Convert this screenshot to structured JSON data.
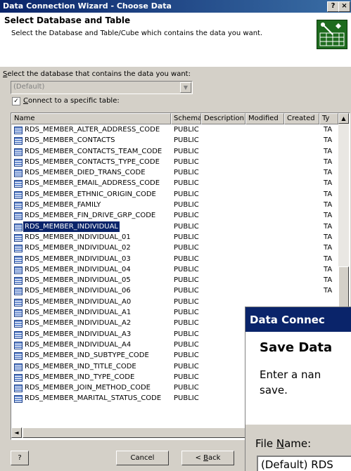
{
  "window": {
    "title": "Data Connection Wizard - Choose Data",
    "help_label": "?",
    "close_label": "×"
  },
  "header": {
    "title": "Select Database and Table",
    "subtitle": "Select the Database and Table/Cube which contains the data you want."
  },
  "database": {
    "label_prefix": "S",
    "label_rest": "elect the database that contains the data you want:",
    "value": "(Default)"
  },
  "connect_checkbox": {
    "checked": "✓",
    "label_prefix": "C",
    "label_rest": "onnect to a specific table:"
  },
  "columns": [
    "Name",
    "Schema",
    "Description",
    "Modified",
    "Created",
    "Ty"
  ],
  "rows": [
    {
      "name": "RDS_MEMBER_ALTER_ADDRESS_CODE",
      "schema": "PUBLIC",
      "type": "TA"
    },
    {
      "name": "RDS_MEMBER_CONTACTS",
      "schema": "PUBLIC",
      "type": "TA"
    },
    {
      "name": "RDS_MEMBER_CONTACTS_TEAM_CODE",
      "schema": "PUBLIC",
      "type": "TA"
    },
    {
      "name": "RDS_MEMBER_CONTACTS_TYPE_CODE",
      "schema": "PUBLIC",
      "type": "TA"
    },
    {
      "name": "RDS_MEMBER_DIED_TRANS_CODE",
      "schema": "PUBLIC",
      "type": "TA"
    },
    {
      "name": "RDS_MEMBER_EMAIL_ADDRESS_CODE",
      "schema": "PUBLIC",
      "type": "TA"
    },
    {
      "name": "RDS_MEMBER_ETHNIC_ORIGIN_CODE",
      "schema": "PUBLIC",
      "type": "TA"
    },
    {
      "name": "RDS_MEMBER_FAMILY",
      "schema": "PUBLIC",
      "type": "TA"
    },
    {
      "name": "RDS_MEMBER_FIN_DRIVE_GRP_CODE",
      "schema": "PUBLIC",
      "type": "TA"
    },
    {
      "name": "RDS_MEMBER_INDIVIDUAL",
      "schema": "PUBLIC",
      "type": "TA",
      "selected": true
    },
    {
      "name": "RDS_MEMBER_INDIVIDUAL_01",
      "schema": "PUBLIC",
      "type": "TA"
    },
    {
      "name": "RDS_MEMBER_INDIVIDUAL_02",
      "schema": "PUBLIC",
      "type": "TA"
    },
    {
      "name": "RDS_MEMBER_INDIVIDUAL_03",
      "schema": "PUBLIC",
      "type": "TA"
    },
    {
      "name": "RDS_MEMBER_INDIVIDUAL_04",
      "schema": "PUBLIC",
      "type": "TA"
    },
    {
      "name": "RDS_MEMBER_INDIVIDUAL_05",
      "schema": "PUBLIC",
      "type": "TA"
    },
    {
      "name": "RDS_MEMBER_INDIVIDUAL_06",
      "schema": "PUBLIC",
      "type": "TA"
    },
    {
      "name": "RDS_MEMBER_INDIVIDUAL_A0",
      "schema": "PUBLIC",
      "type": ""
    },
    {
      "name": "RDS_MEMBER_INDIVIDUAL_A1",
      "schema": "PUBLIC",
      "type": ""
    },
    {
      "name": "RDS_MEMBER_INDIVIDUAL_A2",
      "schema": "PUBLIC",
      "type": ""
    },
    {
      "name": "RDS_MEMBER_INDIVIDUAL_A3",
      "schema": "PUBLIC",
      "type": ""
    },
    {
      "name": "RDS_MEMBER_INDIVIDUAL_A4",
      "schema": "PUBLIC",
      "type": ""
    },
    {
      "name": "RDS_MEMBER_IND_SUBTYPE_CODE",
      "schema": "PUBLIC",
      "type": ""
    },
    {
      "name": "RDS_MEMBER_IND_TITLE_CODE",
      "schema": "PUBLIC",
      "type": ""
    },
    {
      "name": "RDS_MEMBER_IND_TYPE_CODE",
      "schema": "PUBLIC",
      "type": ""
    },
    {
      "name": "RDS_MEMBER_JOIN_METHOD_CODE",
      "schema": "PUBLIC",
      "type": ""
    },
    {
      "name": "RDS_MEMBER_MARITAL_STATUS_CODE",
      "schema": "PUBLIC",
      "type": ""
    }
  ],
  "buttons": {
    "help": "?",
    "cancel": "Cancel",
    "back_prefix": "< ",
    "back_key": "B",
    "back_rest": "ack"
  },
  "overlay": {
    "title": "Data Connec",
    "heading": "Save Data",
    "subtitle_line1": "Enter a nan",
    "subtitle_line2": "save.",
    "file_label_prefix": "File ",
    "file_label_key": "N",
    "file_label_rest": "ame:",
    "file_value": "(Default) RDS"
  },
  "colors": {
    "title_bar": "#0a246a",
    "selection": "#0a246a",
    "face": "#d4d0c8"
  }
}
